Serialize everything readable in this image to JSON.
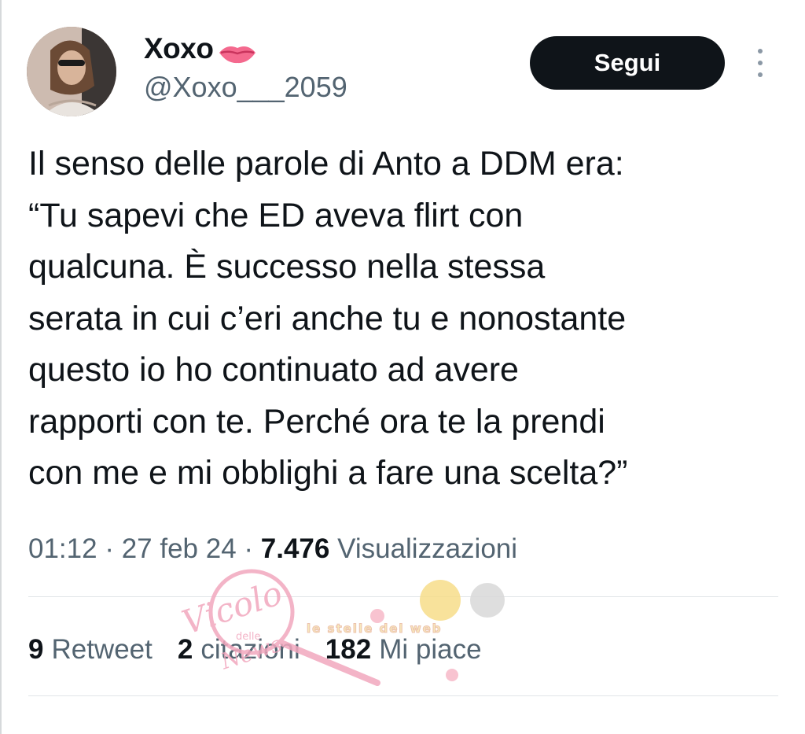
{
  "user": {
    "display_name": "Xoxo",
    "handle": "@Xoxo___2059",
    "name_emoji": "lips-icon",
    "avatar": "profile-photo"
  },
  "actions": {
    "follow_label": "Segui",
    "more_icon": "more-vertical-icon"
  },
  "tweet": {
    "text": "Il senso delle parole di Anto a DDM era:\n“Tu sapevi che ED aveva flirt con\nqualcuna. È successo nella stessa\nserata in cui c’eri anche tu e nonostante\nquesto io ho continuato ad avere\nrapporti con te. Perché ora te la prendi\ncon me e mi obblighi a fare una scelta?”"
  },
  "meta": {
    "time": "01:12",
    "sep1": " · ",
    "date": "27 feb 24",
    "sep2": " · ",
    "views_count": "7.476",
    "views_label": "Visualizzazioni"
  },
  "stats": {
    "retweets_count": "9",
    "retweets_label": "Retweet",
    "quotes_count": "2",
    "quotes_label": "citazioni",
    "likes_count": "182",
    "likes_label": "Mi piace"
  },
  "watermark": {
    "brand": "Vicolo",
    "small": "delle",
    "tail": "News",
    "banner": "le stelle del web"
  },
  "colors": {
    "text": "#0f1419",
    "secondary": "#536471",
    "button_bg": "#0f1419",
    "button_text": "#ffffff",
    "divider": "#e1e5e8",
    "watermark": "#f2a7be"
  }
}
